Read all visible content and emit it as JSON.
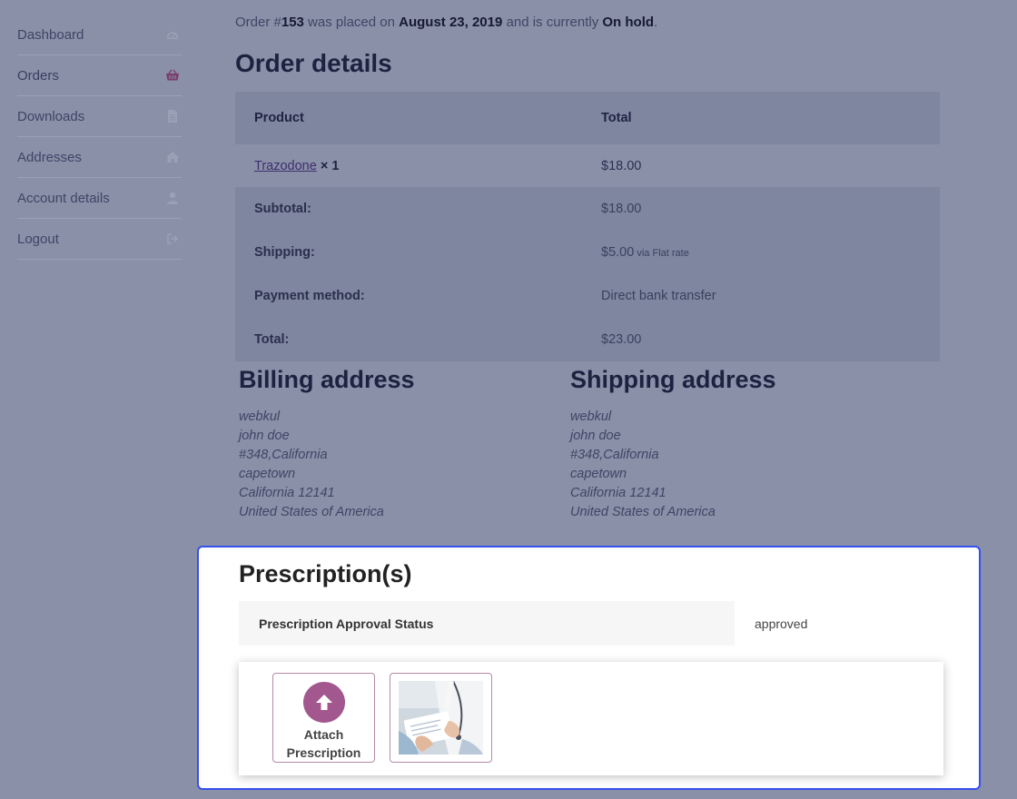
{
  "sidebar": {
    "items": [
      {
        "label": "Dashboard",
        "icon": "dashboard-icon"
      },
      {
        "label": "Orders",
        "icon": "basket-icon",
        "active": true
      },
      {
        "label": "Downloads",
        "icon": "file-icon"
      },
      {
        "label": "Addresses",
        "icon": "home-icon"
      },
      {
        "label": "Account details",
        "icon": "user-icon"
      },
      {
        "label": "Logout",
        "icon": "sign-out-icon"
      }
    ]
  },
  "order": {
    "prefix": "Order #",
    "number": "153",
    "mid": " was placed on ",
    "date": "August 23, 2019",
    "mid2": " and is currently ",
    "status": "On hold",
    "suffix": "."
  },
  "details": {
    "title": "Order details",
    "head": {
      "product": "Product",
      "total": "Total"
    },
    "item": {
      "name": "Trazodone",
      "qty": " × 1",
      "total": "$18.00"
    },
    "subtotal": {
      "label": "Subtotal:",
      "value": "$18.00"
    },
    "shipping": {
      "label": "Shipping:",
      "value": "$5.00",
      "note": " via Flat rate"
    },
    "payment": {
      "label": "Payment method:",
      "value": "Direct bank transfer"
    },
    "total": {
      "label": "Total:",
      "value": "$23.00"
    }
  },
  "billing": {
    "title": "Billing address",
    "lines": [
      "webkul",
      "john doe",
      "#348,California",
      "capetown",
      "California 12141",
      "United States of America"
    ]
  },
  "shipping_address": {
    "title": "Shipping address",
    "lines": [
      "webkul",
      "john doe",
      "#348,California",
      "capetown",
      "California 12141",
      "United States of America"
    ]
  },
  "prescription": {
    "title": "Prescription(s)",
    "status_label": "Prescription Approval Status",
    "status_value": "approved",
    "attach_line1": "Attach",
    "attach_line2": "Prescription"
  },
  "colors": {
    "accent": "#a3578f",
    "panel_border": "#3550ee",
    "overlay": "#8990a7"
  }
}
